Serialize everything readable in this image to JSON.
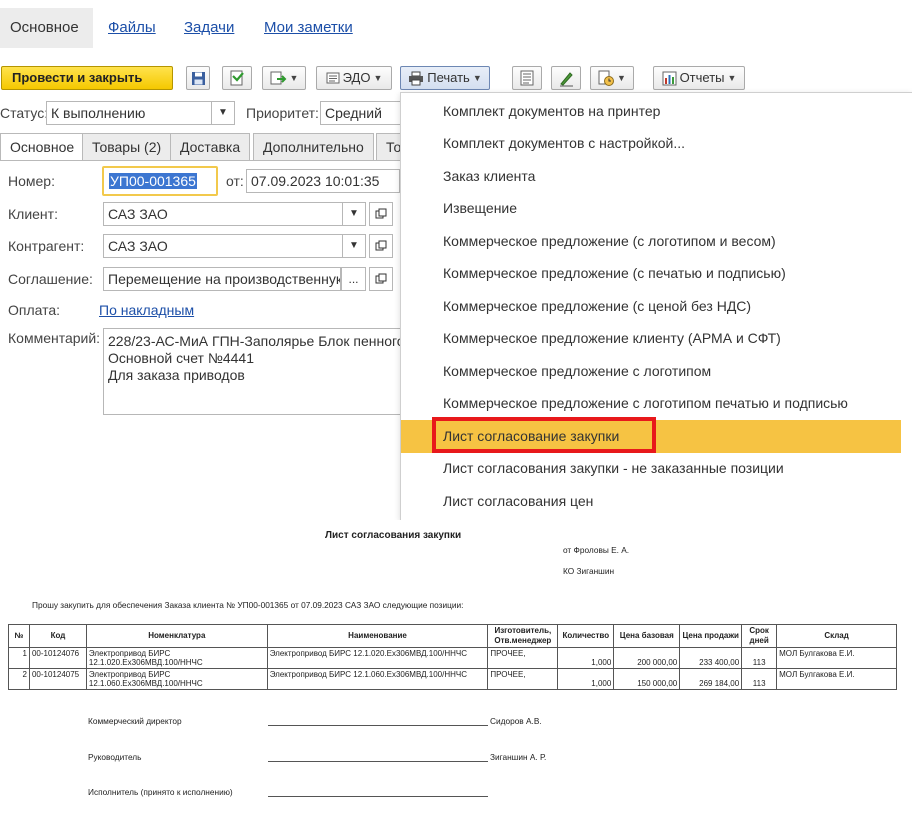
{
  "nav": {
    "tabs": [
      "Основное",
      "Файлы",
      "Задачи",
      "Мои заметки"
    ]
  },
  "toolbar": {
    "post_close": "Провести и закрыть",
    "edo": "ЭДО",
    "print": "Печать",
    "reports": "Отчеты"
  },
  "status": {
    "label": "Статус:",
    "value": "К выполнению",
    "priority_label": "Приоритет:",
    "priority_value": "Средний"
  },
  "form_tabs": [
    "Основное",
    "Товары (2)",
    "Доставка",
    "Дополнительно",
    "То"
  ],
  "form": {
    "number_label": "Номер:",
    "number": "УП00-001365",
    "date_label": "от:",
    "date": "07.09.2023 10:01:35",
    "client_label": "Клиент:",
    "client": "САЗ ЗАО",
    "counterparty_label": "Контрагент:",
    "counterparty": "САЗ  ЗАО",
    "agreement_label": "Соглашение:",
    "agreement": "Перемещение на производственнук",
    "payment_label": "Оплата:",
    "payment": "По накладным",
    "comment_label": "Комментарий:",
    "comment_lines": [
      "228/23-АС-МиА ГПН-Заполярье Блок пенного",
      "Основной счет №4441",
      "Для заказа приводов"
    ]
  },
  "print_menu": {
    "items": [
      "Комплект документов на принтер",
      "Комплект документов с настройкой...",
      "Заказ клиента",
      "Извещение",
      "Коммерческое предложение (с логотипом и весом)",
      "Коммерческое предложение (с печатью и подписью)",
      "Коммерческое предложение (с ценой без НДС)",
      "Коммерческое предложение клиенту (АРМА и СФТ)",
      "Коммерческое предложение с логотипом",
      "Коммерческое предложение с логотипом печатью и подписью",
      "Лист согласование закупки",
      "Лист согласования закупки - не заказанные позиции",
      "Лист согласования цен"
    ],
    "highlighted_index": 10,
    "highlight_color": "#f6c343",
    "marker_color": "#e8181b"
  },
  "document": {
    "title": "Лист согласования закупки",
    "from": "от Фроловы Е. А.",
    "to": "КО Зиганшин",
    "request": "Прошу закупить для обеспечения Заказа клиента № УП00-001365 от 07.09.2023  САЗ  ЗАО следующие позиции:",
    "headers": [
      "№",
      "Код",
      "Номенклатура",
      "Наименование",
      "Изготовитель, Отв.менеджер",
      "Количество",
      "Цена базовая",
      "Цена продажи",
      "Срок дней",
      "Склад"
    ],
    "rows": [
      {
        "n": "1",
        "code": "00-10124076",
        "nom_1": "Электропривод БИРС",
        "nom_2": "12.1.020.Ex306МВД.100/ННЧС",
        "name": "Электропривод БИРС 12.1.020.Ex306МВД.100/ННЧС",
        "maker": "ПРОЧЕЕ,",
        "qty": "1,000",
        "base_price": "200 000,00",
        "sale_price": "233 400,00",
        "days": "113",
        "warehouse": "МОЛ Булгакова Е.И."
      },
      {
        "n": "2",
        "code": "00-10124075",
        "nom_1": "Электропривод БИРС",
        "nom_2": "12.1.060.Ex306МВД.100/ННЧС",
        "name": "Электропривод БИРС 12.1.060.Ex306МВД.100/ННЧС",
        "maker": "ПРОЧЕЕ,",
        "qty": "1,000",
        "base_price": "150 000,00",
        "sale_price": "269 184,00",
        "days": "113",
        "warehouse": "МОЛ Булгакова Е.И."
      }
    ],
    "signatures": [
      {
        "role": "Коммерческий директор",
        "name": "Сидоров А.В."
      },
      {
        "role": "Руководитель",
        "name": "Зиганшин А. Р."
      },
      {
        "role": "Исполнитель (принято к исполнению)",
        "name": ""
      }
    ]
  }
}
